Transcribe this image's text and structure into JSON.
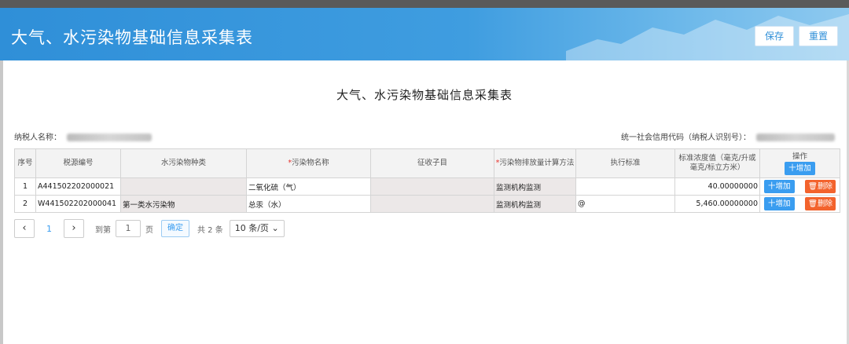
{
  "header": {
    "title": "大气、水污染物基础信息采集表",
    "save_label": "保存",
    "reset_label": "重置"
  },
  "form": {
    "title": "大气、水污染物基础信息采集表",
    "taxpayer_name_label": "纳税人名称：",
    "credit_code_label": "统一社会信用代码（纳税人识别号）："
  },
  "table": {
    "headers": {
      "seq": "序号",
      "source_no": "税源编号",
      "water_type": "水污染物种类",
      "pollutant_name": "污染物名称",
      "sub_item": "征收子目",
      "calc_method": "污染物排放量计算方法",
      "standard": "执行标准",
      "concentration": "标准浓度值（毫克/升或毫克/标立方米）",
      "ops": "操作",
      "add": "十增加"
    },
    "rows": [
      {
        "seq": "1",
        "source_no": "A441502202000021",
        "water_type": "",
        "pollutant_name": "二氧化硫（气）",
        "sub_item": "",
        "calc_method": "监测机构监测",
        "standard": "",
        "concentration": "40.00000000",
        "add": "十增加",
        "del": "删除"
      },
      {
        "seq": "2",
        "source_no": "W441502202000041",
        "water_type": "第一类水污染物",
        "pollutant_name": "总汞（水）",
        "sub_item": "",
        "calc_method": "监测机构监测",
        "standard": "@",
        "concentration": "5,460.00000000",
        "add": "十增加",
        "del": "删除"
      }
    ]
  },
  "pager": {
    "prev": "‹",
    "current": "1",
    "next": "›",
    "goto_label": "到第",
    "page_input": "1",
    "page_unit": "页",
    "confirm": "确定",
    "total": "共 2 条",
    "page_size": "10 条/页"
  }
}
